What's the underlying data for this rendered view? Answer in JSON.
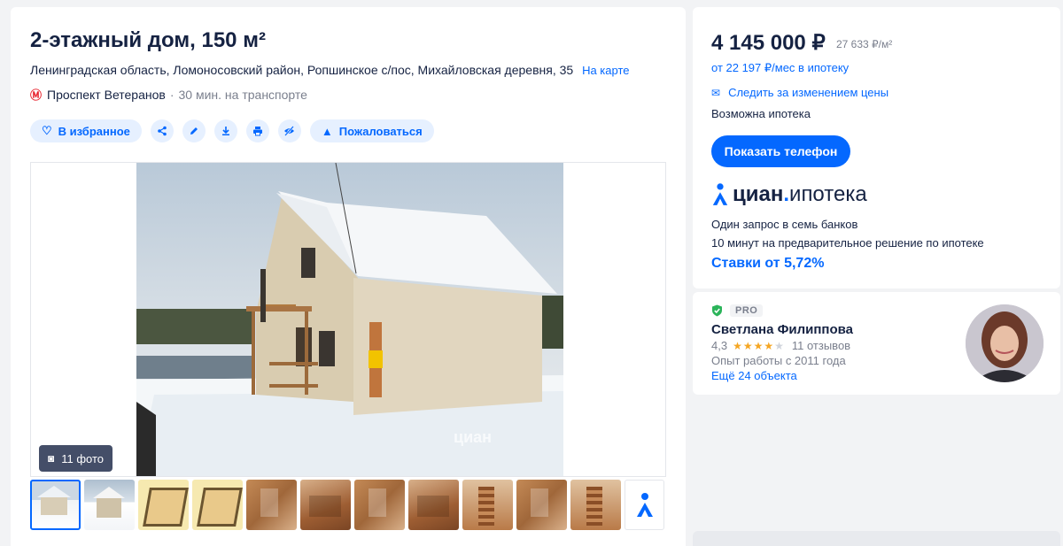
{
  "listing": {
    "title": "2-этажный дом, 150 м²",
    "address": "Ленинградская область, Ломоносовский район, Ропшинское с/пос, Михайловская деревня, 35",
    "map_link": "На карте",
    "metro_station": "Проспект Ветеранов",
    "transit_time": "30 мин. на транспорте"
  },
  "actions": {
    "favorite_label": "В избранное",
    "report_label": "Пожаловаться"
  },
  "gallery": {
    "photo_count": "11 фото",
    "watermark": "циан"
  },
  "price_card": {
    "price": "4 145 000 ₽",
    "price_per_m2": "27 633 ₽/м²",
    "mortgage_from": "от 22 197 ₽/мес в ипотеку",
    "follow_price": "Следить за изменением цены",
    "mortgage_possible": "Возможна ипотека",
    "show_phone": "Показать телефон",
    "cian_brand": "циан",
    "cian_sub": "ипотека",
    "bank_line1": "Один запрос в семь банков",
    "bank_line2": "10 минут на предварительное решение по ипотеке",
    "rate": "Ставки от 5,72%"
  },
  "agent": {
    "badge": "PRO",
    "name": "Светлана Филиппова",
    "rating": "4,3",
    "rating_value": 4.3,
    "reviews": "11 отзывов",
    "experience": "Опыт работы с 2011 года",
    "more_objects": "Ещё 24 объекта"
  },
  "colors": {
    "accent": "#0468ff",
    "text": "#152242",
    "muted": "#7a7f8d",
    "metro": "#e8232e",
    "star": "#f5a623",
    "verified": "#2bb45a"
  }
}
